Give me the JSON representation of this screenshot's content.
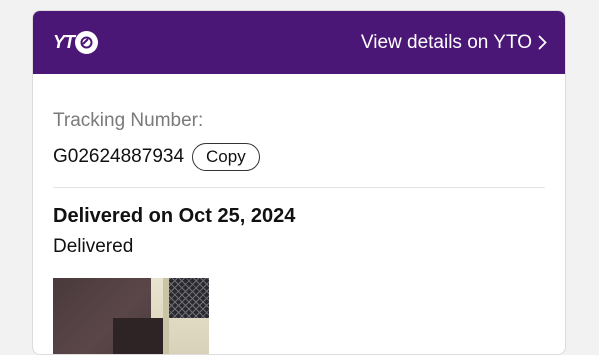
{
  "header": {
    "logo_text": "YT",
    "link_label": "View details on YTO",
    "background_color": "#4b1776",
    "icons": [
      "yto-logo-icon",
      "chevron-right-icon"
    ]
  },
  "tracking": {
    "label": "Tracking Number:",
    "number": "G02624887934",
    "copy_label": "Copy"
  },
  "status": {
    "title": "Delivered on Oct 25, 2024",
    "subtitle": "Delivered"
  }
}
